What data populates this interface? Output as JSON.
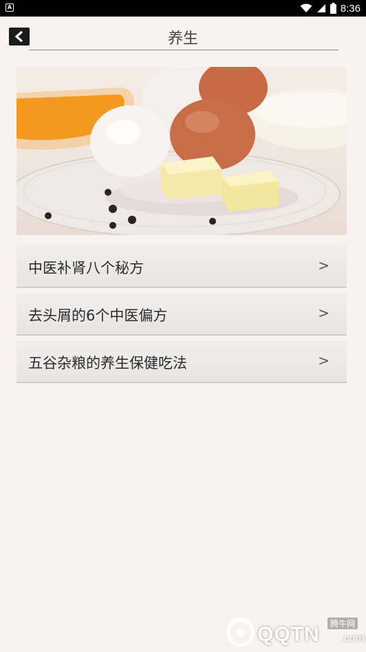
{
  "status_bar": {
    "app_icon_text": "A",
    "time": "8:36"
  },
  "header": {
    "title": "养生"
  },
  "menu": {
    "items": [
      {
        "label": "中医补肾八个秘方",
        "arrow": ">"
      },
      {
        "label": "去头屑的6个中医偏方",
        "arrow": ">"
      },
      {
        "label": "五谷杂粮的养生保健吃法",
        "arrow": ">"
      }
    ]
  },
  "watermark": {
    "site_cn": "腾牛网",
    "logo_text": "QQTN",
    "suffix": ".com"
  },
  "icons": {
    "back": "chevron-left-icon",
    "wifi": "wifi-icon",
    "signal": "signal-icon",
    "battery": "battery-icon"
  },
  "colors": {
    "background": "#f8f3f0",
    "status_bar": "#000000",
    "row_bg": "#ebe9e7"
  }
}
